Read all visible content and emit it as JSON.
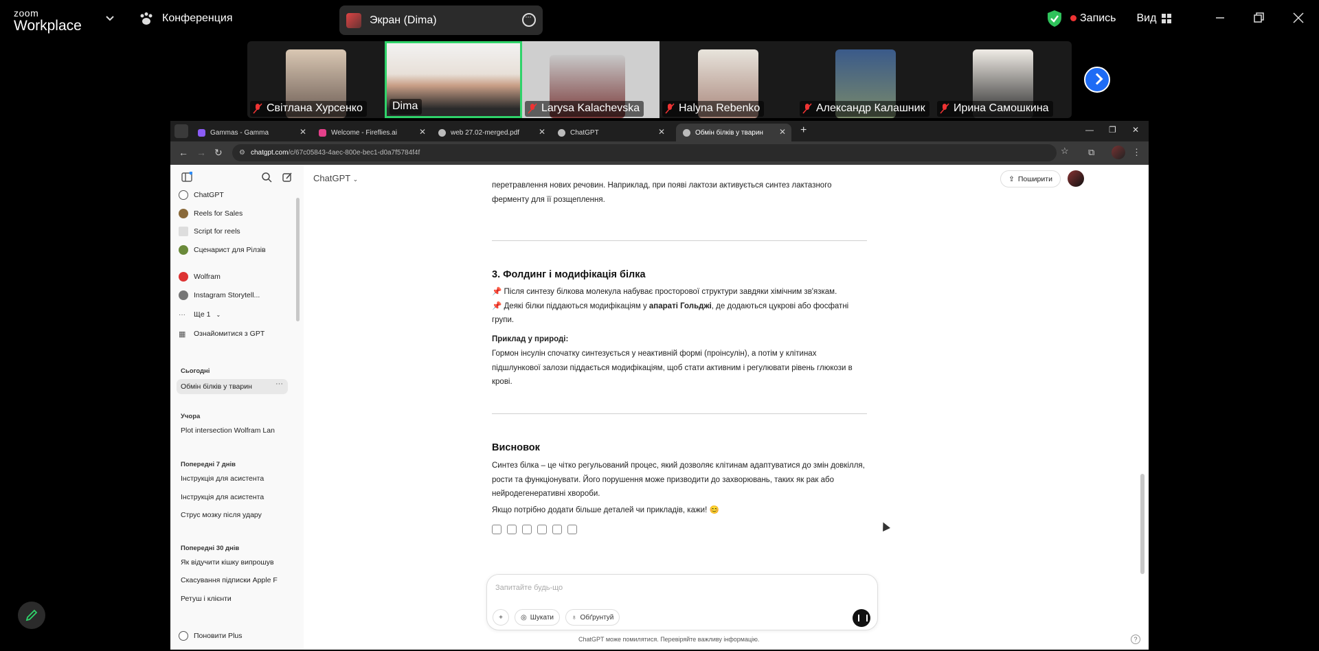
{
  "zoom": {
    "logo_top": "zoom",
    "logo_bottom": "Workplace",
    "meeting_label": "Конференция",
    "share_label": "Экран (Dima)",
    "record_label": "Запись",
    "view_label": "Вид",
    "colors": {
      "active_border": "#2fd36a",
      "record_dot": "#e33333",
      "next_button": "#1e6cf5"
    }
  },
  "participants": [
    {
      "name": "Світлана Хурсенко",
      "muted": true
    },
    {
      "name": "Dima",
      "muted": false,
      "active": true
    },
    {
      "name": "Larysa Kalachevska",
      "muted": true
    },
    {
      "name": "Halyna Rebenko",
      "muted": true
    },
    {
      "name": "Александр Калашник",
      "muted": true
    },
    {
      "name": "Ирина Самошкина",
      "muted": true
    }
  ],
  "browser": {
    "tabs": [
      {
        "label": "Gammas - Gamma",
        "color": "#8b5cf6"
      },
      {
        "label": "Welcome - Fireflies.ai",
        "color": "#e4408a"
      },
      {
        "label": "web 27.02-merged.pdf",
        "color": "#bbbbbb"
      },
      {
        "label": "ChatGPT",
        "color": "#bbbbbb"
      },
      {
        "label": "Обмін білків у тварин",
        "color": "#bbbbbb",
        "active": true
      }
    ],
    "url_host": "chatgpt.com",
    "url_path": "/c/67c05843-4aec-800e-bec1-d0a7f5784f4f"
  },
  "sidebar": {
    "gpts": [
      {
        "label": "ChatGPT",
        "color": "#555555"
      },
      {
        "label": "Reels for Sales",
        "color": "#8a6a3a"
      },
      {
        "label": "Script for reels",
        "color": "#dddddd"
      },
      {
        "label": "Сценарист для Рілзів",
        "color": "#6a8a3a"
      },
      {
        "label": "Wolfram",
        "color": "#d33333"
      },
      {
        "label": "Instagram Storytell...",
        "color": "#777777"
      }
    ],
    "more_label": "Ще 1",
    "explore_label": "Ознайомитися з GPT",
    "sections": [
      {
        "title": "Сьогодні",
        "items": [
          "Обмін білків у тварин"
        ]
      },
      {
        "title": "Учора",
        "items": [
          "Plot intersection Wolfram Lan"
        ]
      },
      {
        "title": "Попередні 7 днів",
        "items": [
          "Інструкція для асистента",
          "Інструкція для асистента",
          "Струс мозку після удару"
        ]
      },
      {
        "title": "Попередні 30 днів",
        "items": [
          "Як відучити кішку випрошув",
          "Скасування підписки Apple F",
          "Ретуш і клієнти"
        ]
      }
    ],
    "upgrade_label": "Поновити Plus"
  },
  "main": {
    "model_label": "ChatGPT",
    "share_label": "Поширити",
    "intro_lines": [
      "перетравлення нових речовин. Наприклад, при появі лактози активується синтез лактазного",
      "ферменту для її розщеплення."
    ],
    "section3_title": "3. Фолдинг і модифікація білка",
    "section3_line1": "📌 Після синтезу білкова молекула набуває просторової структури завдяки хімічним зв'язкам.",
    "section3_line2_pre": "📌 Деякі білки піддаються модифікаціям у ",
    "section3_line2_bold": "апараті Гольджі",
    "section3_line2_post": ", де додаються цукрові або фосфатні групи.",
    "example_label": "Приклад у природі:",
    "example_text": "Гормон інсулін спочатку синтезується у неактивній формі (проінсулін), а потім у клітинах підшлункової залози піддається модифікаціям, щоб стати активним і регулювати рівень глюкози в крові.",
    "conclusion_title": "Висновок",
    "conclusion_text": "Синтез білка – це чітко регульований процес, який дозволяє клітинам адаптуватися до змін довкілля, рости та функціонувати. Його порушення може призводити до захворювань, таких як рак або нейродегенеративні хвороби.",
    "closing_text": "Якщо потрібно додати більше деталей чи прикладів, кажи! 😊"
  },
  "composer": {
    "placeholder": "Запитайте будь-що",
    "search_label": "Шукати",
    "reason_label": "Обґрунтуй",
    "disclaimer": "ChatGPT може помилятися. Перевіряйте важливу інформацію."
  }
}
